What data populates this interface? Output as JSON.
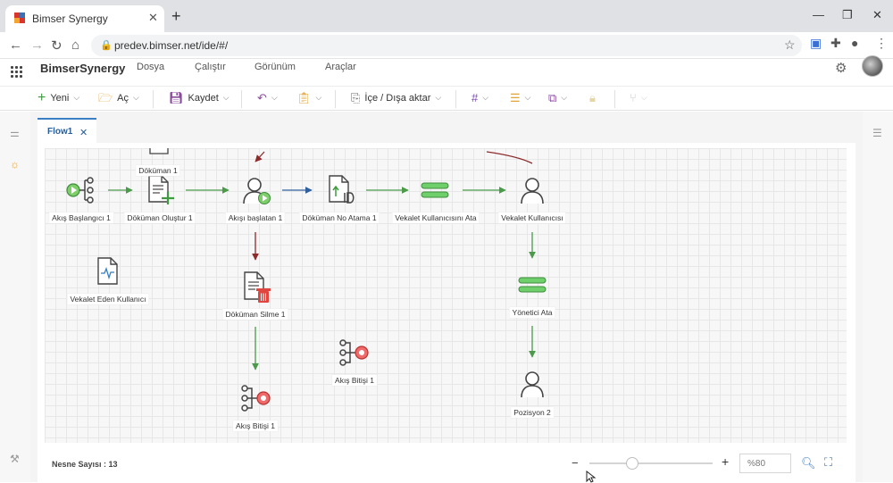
{
  "browser": {
    "tab_title": "Bimser Synergy",
    "url": "predev.bimser.net/ide/#/"
  },
  "app": {
    "brand": "BimserSynergy",
    "menu": [
      "Dosya",
      "Çalıştır",
      "Görünüm",
      "Araçlar"
    ]
  },
  "toolbar": {
    "new_label": "Yeni",
    "open_label": "Aç",
    "save_label": "Kaydet",
    "import_export_label": "İçe / Dışa aktar"
  },
  "flow_tab": {
    "label": "Flow1"
  },
  "nodes": {
    "document1": "Döküman 1",
    "flow_start1": "Akış Başlangıcı 1",
    "doc_create1": "Döküman Oluştur 1",
    "flow_initiator1": "Akışı başlatan 1",
    "doc_number1": "Döküman No Atama 1",
    "proxy_user_assign": "Vekalet Kullanıcısını Ata",
    "proxy_user": "Vekalet Kullanıcısı",
    "proxy_giver_user": "Vekalet Eden Kullanıcı",
    "doc_delete1": "Döküman Silme 1",
    "manager_assign": "Yönetici Ata",
    "flow_end1": "Akış Bitişi 1",
    "flow_end1_b": "Akış Bitişi 1",
    "position2": "Pozisyon 2"
  },
  "status": {
    "object_count": "Nesne Sayısı : 13",
    "zoom_value": "%80",
    "zoom_level": 0.35
  },
  "colors": {
    "accent": "#3a7fc4",
    "green_connector": "#4a9a4a",
    "red_connector": "#8e2a2a",
    "blue_connector": "#2f5f9e"
  }
}
